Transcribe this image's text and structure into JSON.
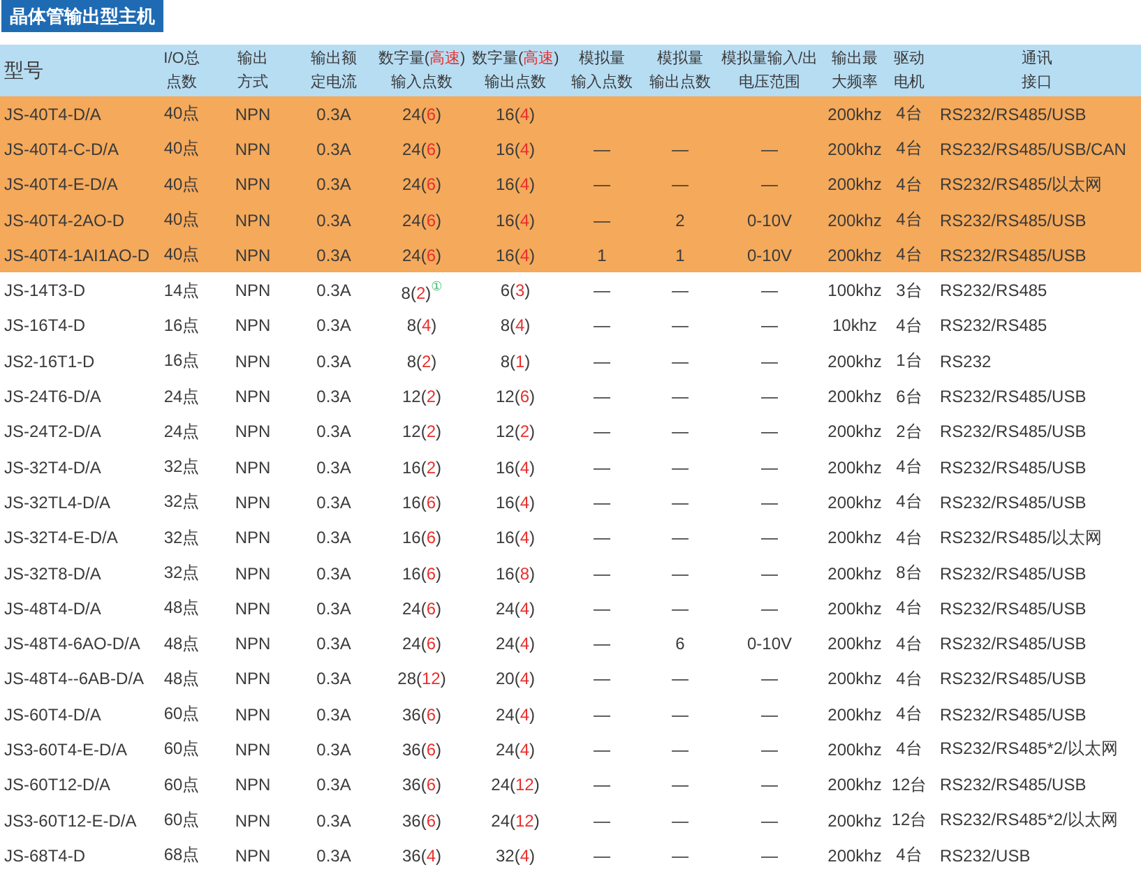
{
  "title": "晶体管输出型主机",
  "columns": [
    {
      "lines": [
        "型号"
      ]
    },
    {
      "lines": [
        "I/O总",
        "点数"
      ]
    },
    {
      "lines": [
        "输出",
        "方式"
      ]
    },
    {
      "lines": [
        "输出额",
        "定电流"
      ]
    },
    {
      "lines": [
        [
          {
            "text": "数字量("
          },
          {
            "text": "高速",
            "kind": "fast"
          },
          {
            "text": ")"
          }
        ],
        "输入点数"
      ]
    },
    {
      "lines": [
        [
          {
            "text": "数字量("
          },
          {
            "text": "高速",
            "kind": "fast"
          },
          {
            "text": ")"
          }
        ],
        "输出点数"
      ]
    },
    {
      "lines": [
        "模拟量",
        "输入点数"
      ]
    },
    {
      "lines": [
        "模拟量",
        "输出点数"
      ]
    },
    {
      "lines": [
        "模拟量输入/出",
        "电压范围"
      ]
    },
    {
      "lines": [
        "输出最",
        "大频率"
      ]
    },
    {
      "lines": [
        "驱动",
        "电机"
      ]
    },
    {
      "lines": [
        "通讯",
        "接口"
      ]
    }
  ],
  "rows": [
    {
      "highlighted": true,
      "cells": [
        "JS-40T4-D/A",
        "40点",
        "NPN",
        "0.3A",
        [
          {
            "text": "24("
          },
          {
            "text": "6",
            "kind": "fast"
          },
          {
            "text": ")"
          }
        ],
        [
          {
            "text": "16("
          },
          {
            "text": "4",
            "kind": "fast"
          },
          {
            "text": ")"
          }
        ],
        null,
        null,
        null,
        "200khz",
        "4台",
        "RS232/RS485/USB"
      ]
    },
    {
      "highlighted": true,
      "cells": [
        "JS-40T4-C-D/A",
        "40点",
        "NPN",
        "0.3A",
        [
          {
            "text": "24("
          },
          {
            "text": "6",
            "kind": "fast"
          },
          {
            "text": ")"
          }
        ],
        [
          {
            "text": "16("
          },
          {
            "text": "4",
            "kind": "fast"
          },
          {
            "text": ")"
          }
        ],
        "—",
        "—",
        "—",
        "200khz",
        "4台",
        "RS232/RS485/USB/CAN"
      ]
    },
    {
      "highlighted": true,
      "cells": [
        "JS-40T4-E-D/A",
        "40点",
        "NPN",
        "0.3A",
        [
          {
            "text": "24("
          },
          {
            "text": "6",
            "kind": "fast"
          },
          {
            "text": ")"
          }
        ],
        [
          {
            "text": "16("
          },
          {
            "text": "4",
            "kind": "fast"
          },
          {
            "text": ")"
          }
        ],
        "—",
        "—",
        "—",
        "200khz",
        "4台",
        "RS232/RS485/以太网"
      ]
    },
    {
      "highlighted": true,
      "cells": [
        "JS-40T4-2AO-D",
        "40点",
        "NPN",
        "0.3A",
        [
          {
            "text": "24("
          },
          {
            "text": "6",
            "kind": "fast"
          },
          {
            "text": ")"
          }
        ],
        [
          {
            "text": "16("
          },
          {
            "text": "4",
            "kind": "fast"
          },
          {
            "text": ")"
          }
        ],
        "—",
        "2",
        "0-10V",
        "200khz",
        "4台",
        "RS232/RS485/USB"
      ]
    },
    {
      "highlighted": true,
      "cells": [
        "JS-40T4-1AI1AO-D",
        "40点",
        "NPN",
        "0.3A",
        [
          {
            "text": "24("
          },
          {
            "text": "6",
            "kind": "fast"
          },
          {
            "text": ")"
          }
        ],
        [
          {
            "text": "16("
          },
          {
            "text": "4",
            "kind": "fast"
          },
          {
            "text": ")"
          }
        ],
        "1",
        "1",
        "0-10V",
        "200khz",
        "4台",
        "RS232/RS485/USB"
      ]
    },
    {
      "highlighted": false,
      "cells": [
        "JS-14T3-D",
        "14点",
        "NPN",
        "0.3A",
        [
          {
            "text": "8("
          },
          {
            "text": "2",
            "kind": "fast"
          },
          {
            "text": ")"
          },
          {
            "text": "①",
            "kind": "note"
          }
        ],
        [
          {
            "text": "6("
          },
          {
            "text": "3",
            "kind": "fast"
          },
          {
            "text": ")"
          }
        ],
        "—",
        "—",
        "—",
        "100khz",
        "3台",
        "RS232/RS485"
      ]
    },
    {
      "highlighted": false,
      "cells": [
        "JS-16T4-D",
        "16点",
        "NPN",
        "0.3A",
        [
          {
            "text": "8("
          },
          {
            "text": "4",
            "kind": "fast"
          },
          {
            "text": ")"
          }
        ],
        [
          {
            "text": "8("
          },
          {
            "text": "4",
            "kind": "fast"
          },
          {
            "text": ")"
          }
        ],
        "—",
        "—",
        "—",
        "10khz",
        "4台",
        "RS232/RS485"
      ]
    },
    {
      "highlighted": false,
      "cells": [
        "JS2-16T1-D",
        "16点",
        "NPN",
        "0.3A",
        [
          {
            "text": "8("
          },
          {
            "text": "2",
            "kind": "fast"
          },
          {
            "text": ")"
          }
        ],
        [
          {
            "text": "8("
          },
          {
            "text": "1",
            "kind": "fast"
          },
          {
            "text": ")"
          }
        ],
        "—",
        "—",
        "—",
        "200khz",
        "1台",
        "RS232"
      ]
    },
    {
      "highlighted": false,
      "cells": [
        "JS-24T6-D/A",
        "24点",
        "NPN",
        "0.3A",
        [
          {
            "text": "12("
          },
          {
            "text": "2",
            "kind": "fast"
          },
          {
            "text": ")"
          }
        ],
        [
          {
            "text": "12("
          },
          {
            "text": "6",
            "kind": "fast"
          },
          {
            "text": ")"
          }
        ],
        "—",
        "—",
        "—",
        "200khz",
        "6台",
        "RS232/RS485/USB"
      ]
    },
    {
      "highlighted": false,
      "cells": [
        "JS-24T2-D/A",
        "24点",
        "NPN",
        "0.3A",
        [
          {
            "text": "12("
          },
          {
            "text": "2",
            "kind": "fast"
          },
          {
            "text": ")"
          }
        ],
        [
          {
            "text": "12("
          },
          {
            "text": "2",
            "kind": "fast"
          },
          {
            "text": ")"
          }
        ],
        "—",
        "—",
        "—",
        "200khz",
        "2台",
        "RS232/RS485/USB"
      ]
    },
    {
      "highlighted": false,
      "cells": [
        "JS-32T4-D/A",
        "32点",
        "NPN",
        "0.3A",
        [
          {
            "text": "16("
          },
          {
            "text": "2",
            "kind": "fast"
          },
          {
            "text": ")"
          }
        ],
        [
          {
            "text": "16("
          },
          {
            "text": "4",
            "kind": "fast"
          },
          {
            "text": ")"
          }
        ],
        "—",
        "—",
        "—",
        "200khz",
        "4台",
        "RS232/RS485/USB"
      ]
    },
    {
      "highlighted": false,
      "cells": [
        "JS-32TL4-D/A",
        "32点",
        "NPN",
        "0.3A",
        [
          {
            "text": "16("
          },
          {
            "text": "6",
            "kind": "fast"
          },
          {
            "text": ")"
          }
        ],
        [
          {
            "text": "16("
          },
          {
            "text": "4",
            "kind": "fast"
          },
          {
            "text": ")"
          }
        ],
        "—",
        "—",
        "—",
        "200khz",
        "4台",
        "RS232/RS485/USB"
      ]
    },
    {
      "highlighted": false,
      "cells": [
        "JS-32T4-E-D/A",
        "32点",
        "NPN",
        "0.3A",
        [
          {
            "text": "16("
          },
          {
            "text": "6",
            "kind": "fast"
          },
          {
            "text": ")"
          }
        ],
        [
          {
            "text": "16("
          },
          {
            "text": "4",
            "kind": "fast"
          },
          {
            "text": ")"
          }
        ],
        "—",
        "—",
        "—",
        "200khz",
        "4台",
        "RS232/RS485/以太网"
      ]
    },
    {
      "highlighted": false,
      "cells": [
        "JS-32T8-D/A",
        "32点",
        "NPN",
        "0.3A",
        [
          {
            "text": "16("
          },
          {
            "text": "6",
            "kind": "fast"
          },
          {
            "text": ")"
          }
        ],
        [
          {
            "text": "16("
          },
          {
            "text": "8",
            "kind": "fast"
          },
          {
            "text": ")"
          }
        ],
        "—",
        "—",
        "—",
        "200khz",
        "8台",
        "RS232/RS485/USB"
      ]
    },
    {
      "highlighted": false,
      "cells": [
        "JS-48T4-D/A",
        "48点",
        "NPN",
        "0.3A",
        [
          {
            "text": "24("
          },
          {
            "text": "6",
            "kind": "fast"
          },
          {
            "text": ")"
          }
        ],
        [
          {
            "text": "24("
          },
          {
            "text": "4",
            "kind": "fast"
          },
          {
            "text": ")"
          }
        ],
        "—",
        "—",
        "—",
        "200khz",
        "4台",
        "RS232/RS485/USB"
      ]
    },
    {
      "highlighted": false,
      "cells": [
        "JS-48T4-6AO-D/A",
        "48点",
        "NPN",
        "0.3A",
        [
          {
            "text": "24("
          },
          {
            "text": "6",
            "kind": "fast"
          },
          {
            "text": ")"
          }
        ],
        [
          {
            "text": "24("
          },
          {
            "text": "4",
            "kind": "fast"
          },
          {
            "text": ")"
          }
        ],
        "—",
        "6",
        "0-10V",
        "200khz",
        "4台",
        "RS232/RS485/USB"
      ]
    },
    {
      "highlighted": false,
      "cells": [
        "JS-48T4--6AB-D/A",
        "48点",
        "NPN",
        "0.3A",
        [
          {
            "text": "28("
          },
          {
            "text": "12",
            "kind": "fast"
          },
          {
            "text": ")"
          }
        ],
        [
          {
            "text": "20("
          },
          {
            "text": "4",
            "kind": "fast"
          },
          {
            "text": ")"
          }
        ],
        "—",
        "—",
        "—",
        "200khz",
        "4台",
        "RS232/RS485/USB"
      ]
    },
    {
      "highlighted": false,
      "cells": [
        "JS-60T4-D/A",
        "60点",
        "NPN",
        "0.3A",
        [
          {
            "text": "36("
          },
          {
            "text": "6",
            "kind": "fast"
          },
          {
            "text": ")"
          }
        ],
        [
          {
            "text": "24("
          },
          {
            "text": "4",
            "kind": "fast"
          },
          {
            "text": ")"
          }
        ],
        "—",
        "—",
        "—",
        "200khz",
        "4台",
        "RS232/RS485/USB"
      ]
    },
    {
      "highlighted": false,
      "cells": [
        "JS3-60T4-E-D/A",
        "60点",
        "NPN",
        "0.3A",
        [
          {
            "text": "36("
          },
          {
            "text": "6",
            "kind": "fast"
          },
          {
            "text": ")"
          }
        ],
        [
          {
            "text": "24("
          },
          {
            "text": "4",
            "kind": "fast"
          },
          {
            "text": ")"
          }
        ],
        "—",
        "—",
        "—",
        "200khz",
        "4台",
        "RS232/RS485*2/以太网"
      ]
    },
    {
      "highlighted": false,
      "cells": [
        "JS-60T12-D/A",
        "60点",
        "NPN",
        "0.3A",
        [
          {
            "text": "36("
          },
          {
            "text": "6",
            "kind": "fast"
          },
          {
            "text": ")"
          }
        ],
        [
          {
            "text": "24("
          },
          {
            "text": "12",
            "kind": "fast"
          },
          {
            "text": ")"
          }
        ],
        "—",
        "—",
        "—",
        "200khz",
        "12台",
        "RS232/RS485/USB"
      ]
    },
    {
      "highlighted": false,
      "cells": [
        "JS3-60T12-E-D/A",
        "60点",
        "NPN",
        "0.3A",
        [
          {
            "text": "36("
          },
          {
            "text": "6",
            "kind": "fast"
          },
          {
            "text": ")"
          }
        ],
        [
          {
            "text": "24("
          },
          {
            "text": "12",
            "kind": "fast"
          },
          {
            "text": ")"
          }
        ],
        "—",
        "—",
        "—",
        "200khz",
        "12台",
        "RS232/RS485*2/以太网"
      ]
    },
    {
      "highlighted": false,
      "cells": [
        "JS-68T4-D",
        "68点",
        "NPN",
        "0.3A",
        [
          {
            "text": "36("
          },
          {
            "text": "4",
            "kind": "fast"
          },
          {
            "text": ")"
          }
        ],
        [
          {
            "text": "32("
          },
          {
            "text": "4",
            "kind": "fast"
          },
          {
            "text": ")"
          }
        ],
        "—",
        "—",
        "—",
        "200khz",
        "4台",
        "RS232/USB"
      ]
    }
  ]
}
